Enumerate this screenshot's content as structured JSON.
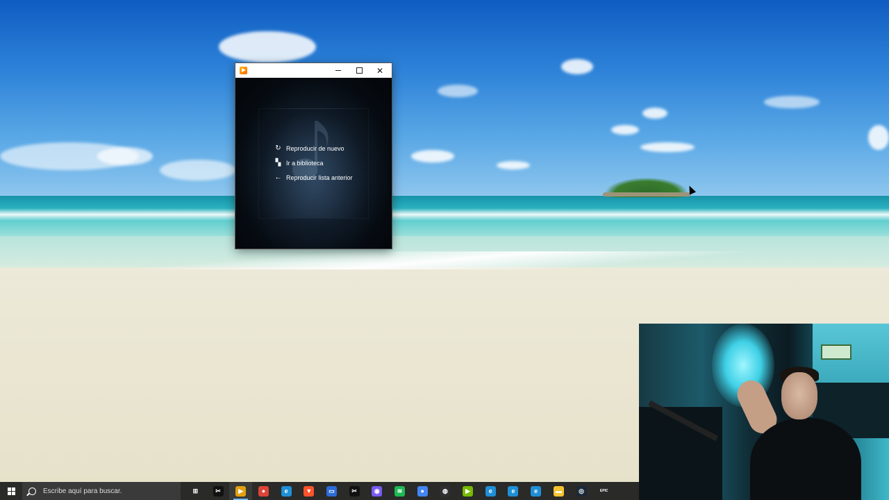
{
  "player": {
    "menu": [
      {
        "label": "Reproducir de nuevo",
        "icon": "replay-icon"
      },
      {
        "label": "Ir a biblioteca",
        "icon": "library-icon"
      },
      {
        "label": "Reproducir lista anterior",
        "icon": "back-arrow-icon"
      }
    ]
  },
  "taskbar": {
    "search_placeholder": "Escribe aquí para buscar.",
    "apps": [
      {
        "name": "task-view",
        "glyph": "⊞",
        "color": "transparent"
      },
      {
        "name": "capcut",
        "glyph": "✂",
        "color": "#111"
      },
      {
        "name": "media-player",
        "glyph": "▶",
        "color": "#e2a012"
      },
      {
        "name": "chrome",
        "glyph": "●",
        "color": "#db4437"
      },
      {
        "name": "edge",
        "glyph": "e",
        "color": "#1f8fd6"
      },
      {
        "name": "brave",
        "glyph": "▼",
        "color": "#fb542b"
      },
      {
        "name": "remote-desktop",
        "glyph": "▭",
        "color": "#2b6cd8"
      },
      {
        "name": "capcut-2",
        "glyph": "✂",
        "color": "#111"
      },
      {
        "name": "discord-ptb",
        "glyph": "◉",
        "color": "#7a5af5"
      },
      {
        "name": "spotify",
        "glyph": "≋",
        "color": "#1db954"
      },
      {
        "name": "chrome-2",
        "glyph": "●",
        "color": "#4285f4"
      },
      {
        "name": "obs",
        "glyph": "◍",
        "color": "#302e31"
      },
      {
        "name": "nvidia",
        "glyph": "▶",
        "color": "#76b900"
      },
      {
        "name": "edge-2",
        "glyph": "e",
        "color": "#1f8fd6"
      },
      {
        "name": "edge-3",
        "glyph": "e",
        "color": "#1f8fd6"
      },
      {
        "name": "edge-4",
        "glyph": "e",
        "color": "#1f8fd6"
      },
      {
        "name": "file-explorer",
        "glyph": "▬",
        "color": "#f4c430"
      },
      {
        "name": "steam",
        "glyph": "◎",
        "color": "#1b2838"
      },
      {
        "name": "epic-games",
        "glyph": "EPIC",
        "color": "#2a2a2a"
      }
    ]
  }
}
